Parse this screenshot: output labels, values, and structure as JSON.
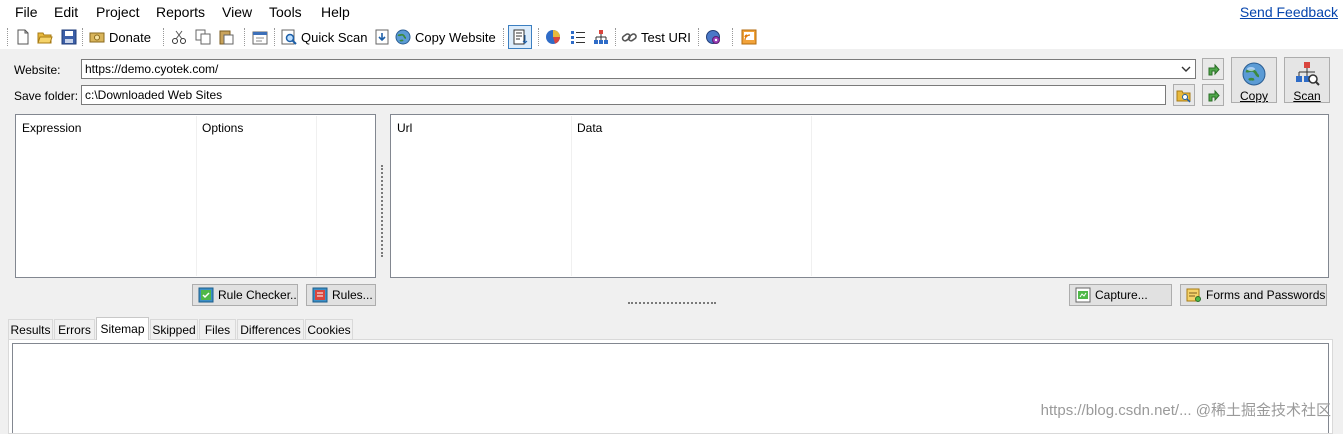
{
  "menu": {
    "file": "File",
    "edit": "Edit",
    "project": "Project",
    "reports": "Reports",
    "view": "View",
    "tools": "Tools",
    "help": "Help",
    "send_feedback": "Send Feedback"
  },
  "toolbar": {
    "donate": "Donate",
    "quick_scan": "Quick Scan",
    "copy_website": "Copy Website",
    "test_uri": "Test URI"
  },
  "form": {
    "website_label": "Website:",
    "website_value": "https://demo.cyotek.com/",
    "save_folder_label": "Save folder:",
    "save_folder_value": "c:\\Downloaded Web Sites",
    "copy_button": "Copy",
    "scan_button": "Scan"
  },
  "rules_panel": {
    "col_expression": "Expression",
    "col_options": "Options"
  },
  "url_panel": {
    "col_url": "Url",
    "col_data": "Data"
  },
  "buttons": {
    "rule_checker": "Rule Checker...",
    "rules": "Rules...",
    "capture": "Capture...",
    "forms_passwords": "Forms and Passwords..."
  },
  "tabs": [
    "Results",
    "Errors",
    "Sitemap",
    "Skipped",
    "Files",
    "Differences",
    "Cookies"
  ],
  "active_tab": "Sitemap",
  "watermark": "https://blog.csdn.net/...  @稀土掘金技术社区",
  "colors": {
    "link": "#0645ad",
    "background": "#f0f0f0",
    "panel_border": "#828790"
  }
}
